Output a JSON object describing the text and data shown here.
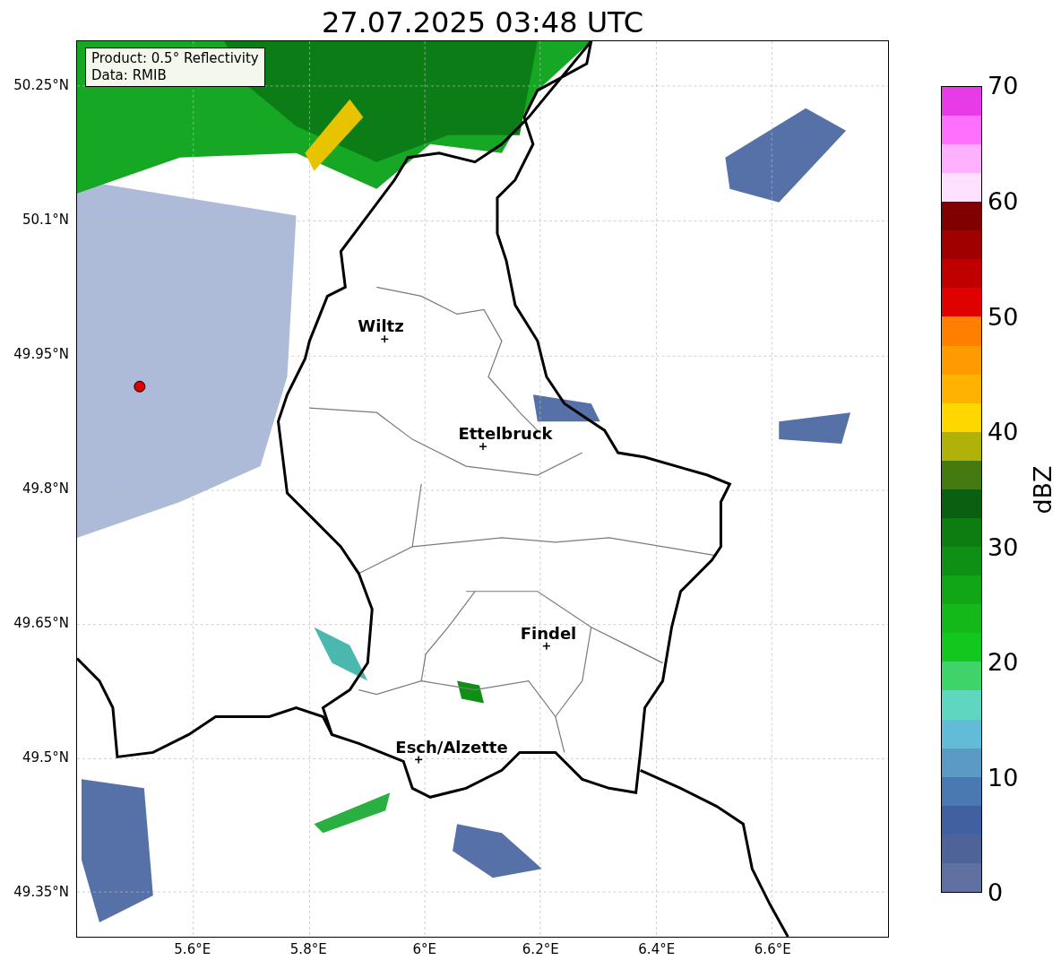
{
  "title": "27.07.2025 03:48 UTC",
  "map": {
    "info_box": [
      "Product: 0.5° Reflectivity",
      "Data: RMIB"
    ],
    "places": [
      {
        "name": "Wiltz"
      },
      {
        "name": "Ettelbruck"
      },
      {
        "name": "Findel"
      },
      {
        "name": "Esch/Alzette"
      }
    ],
    "yticks": [
      "50.25°N",
      "50.1°N",
      "49.95°N",
      "49.8°N",
      "49.65°N",
      "49.5°N",
      "49.35°N"
    ],
    "xticks": [
      "5.6°E",
      "5.8°E",
      "6°E",
      "6.2°E",
      "6.4°E",
      "6.6°E"
    ]
  },
  "colorbar": {
    "label": "dBZ",
    "ticks": [
      "70",
      "60",
      "50",
      "40",
      "30",
      "20",
      "10",
      "0"
    ],
    "bands": [
      {
        "color": "#6070a0"
      },
      {
        "color": "#506399"
      },
      {
        "color": "#4060a0"
      },
      {
        "color": "#4a78b0"
      },
      {
        "color": "#5a9ac5"
      },
      {
        "color": "#62bcd8"
      },
      {
        "color": "#5ed6c0"
      },
      {
        "color": "#3ed46a"
      },
      {
        "color": "#12c81f"
      },
      {
        "color": "#14b81a"
      },
      {
        "color": "#10a616"
      },
      {
        "color": "#0e9015"
      },
      {
        "color": "#0d7d12"
      },
      {
        "color": "#0a6010"
      },
      {
        "color": "#457a10"
      },
      {
        "color": "#b0b20a"
      },
      {
        "color": "#ffd700"
      },
      {
        "color": "#ffb300"
      },
      {
        "color": "#ff9a00"
      },
      {
        "color": "#ff7f00"
      },
      {
        "color": "#e00000"
      },
      {
        "color": "#c00000"
      },
      {
        "color": "#a00000"
      },
      {
        "color": "#800000"
      },
      {
        "color": "#ffe0ff"
      },
      {
        "color": "#ffb0ff"
      },
      {
        "color": "#ff70ff"
      },
      {
        "color": "#e83be8"
      }
    ]
  }
}
